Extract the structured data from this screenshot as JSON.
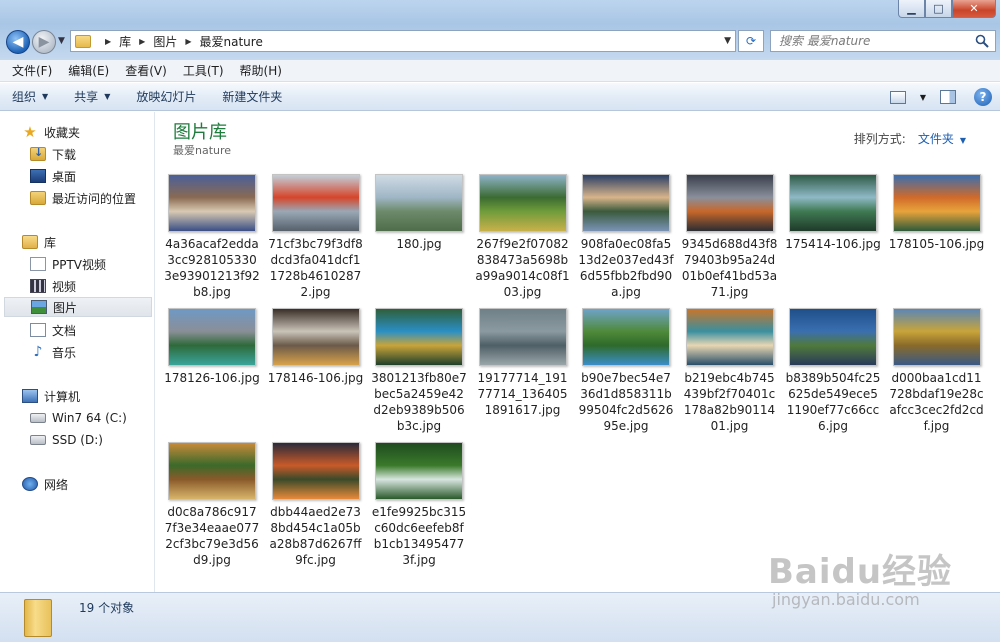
{
  "window": {
    "minimize_glyph": "▁",
    "maximize_glyph": "□",
    "close_glyph": "✕"
  },
  "address_bar": {
    "breadcrumbs": [
      "库",
      "图片",
      "最爱nature"
    ],
    "search_placeholder": "搜索 最爱nature"
  },
  "menubar": {
    "items": [
      "文件(F)",
      "编辑(E)",
      "查看(V)",
      "工具(T)",
      "帮助(H)"
    ]
  },
  "commandbar": {
    "organize": "组织",
    "share": "共享",
    "slideshow": "放映幻灯片",
    "new_folder": "新建文件夹",
    "help": "?"
  },
  "sidebar": {
    "favorites": {
      "header": "收藏夹",
      "items": [
        "下载",
        "桌面",
        "最近访问的位置"
      ]
    },
    "libraries": {
      "header": "库",
      "items": [
        "PPTV视频",
        "视频",
        "图片",
        "文档",
        "音乐"
      ],
      "selected": "图片"
    },
    "computer": {
      "header": "计算机",
      "items": [
        "Win7 64 (C:)",
        "SSD (D:)"
      ]
    },
    "network": {
      "header": "网络"
    }
  },
  "content": {
    "library_title": "图片库",
    "library_subtitle": "最爱nature",
    "arrange_label": "排列方式:",
    "arrange_value": "文件夹",
    "files": [
      {
        "name": "4a36acaf2edda3cc9281053303e93901213f92b8.jpg",
        "colors": [
          "#4b5f9a",
          "#8a6a52",
          "#d8c9b2",
          "#3a4f86"
        ]
      },
      {
        "name": "71cf3bc79f3df8dcd3fa041dcf11728b46102872.jpg",
        "colors": [
          "#c2cfda",
          "#d6452a",
          "#9aa8b6",
          "#55606b"
        ]
      },
      {
        "name": "180.jpg",
        "colors": [
          "#cfdbe4",
          "#9fb6c6",
          "#6d8a6a",
          "#4f6d4a"
        ]
      },
      {
        "name": "267f9e2f07082838473a5698ba99a9014c08f103.jpg",
        "colors": [
          "#8fb3c9",
          "#3c6b32",
          "#6f9c3a",
          "#c8b04a"
        ]
      },
      {
        "name": "908fa0ec08fa513d2e037ed43f6d55fbb2fbd90a.jpg",
        "colors": [
          "#2b3f66",
          "#d8b48a",
          "#3a5a3c",
          "#7a93b6"
        ]
      },
      {
        "name": "9345d688d43f879403b95a24d01b0ef41bd53a71.jpg",
        "colors": [
          "#3a3f4c",
          "#8a8f9c",
          "#c8672a",
          "#2a2d33"
        ]
      },
      {
        "name": "175414-106.jpg",
        "colors": [
          "#2e5a46",
          "#8fb9c6",
          "#3f7a52",
          "#1f3a2a"
        ]
      },
      {
        "name": "178105-106.jpg",
        "colors": [
          "#3a6fb0",
          "#d06a2a",
          "#e8a43a",
          "#2e5a3a"
        ]
      },
      {
        "name": "178126-106.jpg",
        "colors": [
          "#6f99c4",
          "#8a8f96",
          "#2e6a3a",
          "#3aa59a"
        ]
      },
      {
        "name": "178146-106.jpg",
        "colors": [
          "#3a2f28",
          "#c9c3b8",
          "#6b5a4a",
          "#d8a24a"
        ]
      },
      {
        "name": "3801213fb80e7bec5a2459e42d2eb9389b506b3c.jpg",
        "colors": [
          "#2f5f3a",
          "#2a8fc6",
          "#c9a43a",
          "#1f3f2a"
        ]
      },
      {
        "name": "19177714_19177714_1364051891617.jpg",
        "colors": [
          "#6f8086",
          "#8a9aa0",
          "#4f5f66",
          "#9aa6aa"
        ]
      },
      {
        "name": "b90e7bec54e736d1d858311b99504fc2d562695e.jpg",
        "colors": [
          "#6fa3c9",
          "#4f8a3a",
          "#2e6a2a",
          "#3a8fc9"
        ]
      },
      {
        "name": "b219ebc4b745439bf2f70401c178a82b9011401.jpg",
        "colors": [
          "#c9752a",
          "#3a8fa0",
          "#e8d6b2",
          "#2a4f6a"
        ]
      },
      {
        "name": "b8389b504fc25625de549ece51190ef77c66cc6.jpg",
        "colors": [
          "#1f4f8a",
          "#3a6fb0",
          "#4f7a3a",
          "#2a3a5a"
        ]
      },
      {
        "name": "d000baa1cd11728bdaf19e28cafcc3cec2fd2cdf.jpg",
        "colors": [
          "#5a86b6",
          "#c9a43a",
          "#8a6a2a",
          "#3a5a86"
        ]
      },
      {
        "name": "d0c8a786c9177f3e34eaae0772cf3bc79e3d56d9.jpg",
        "colors": [
          "#c98a3a",
          "#3a6a2a",
          "#8a5a2a",
          "#d8b46a"
        ]
      },
      {
        "name": "dbb44aed2e738bd454c1a05ba28b87d6267ff9fc.jpg",
        "colors": [
          "#2a2a3a",
          "#c95a2a",
          "#3a4a2a",
          "#e88a3a"
        ]
      },
      {
        "name": "e1fe9925bc315c60dc6eefeb8fb1cb134954773f.jpg",
        "colors": [
          "#1f4a1f",
          "#3a7a2a",
          "#d8e6e0",
          "#2a5a2a"
        ]
      }
    ]
  },
  "statusbar": {
    "count_text": "19 个对象"
  },
  "watermark": {
    "logo": "Baidu经验",
    "url": "jingyan.baidu.com"
  }
}
